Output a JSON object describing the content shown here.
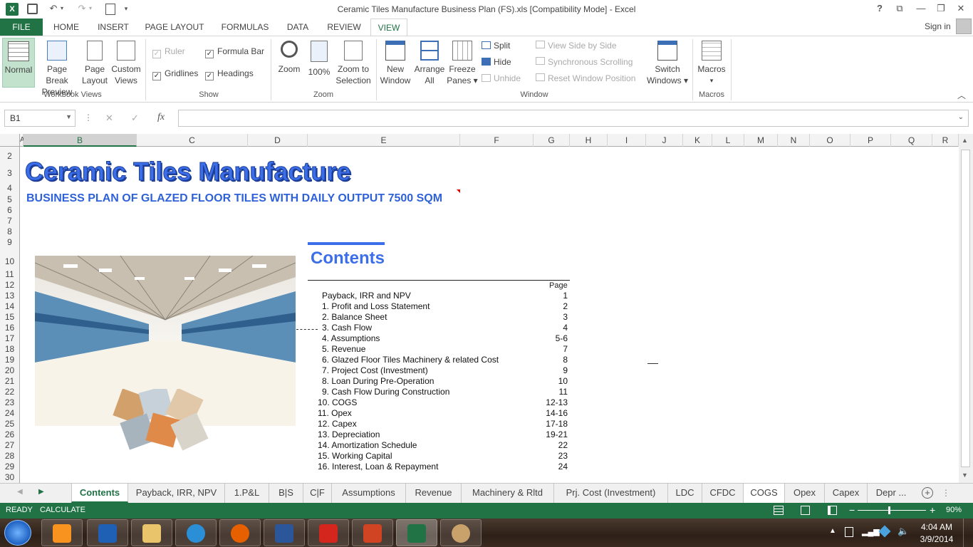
{
  "window": {
    "title": "Ceramic Tiles Manufacture Business Plan (FS).xls  [Compatibility Mode] - Excel",
    "help": "?",
    "sign_in": "Sign in"
  },
  "ribbon_tabs": [
    "FILE",
    "HOME",
    "INSERT",
    "PAGE LAYOUT",
    "FORMULAS",
    "DATA",
    "REVIEW",
    "VIEW"
  ],
  "ribbon": {
    "workbook_views": {
      "label": "Workbook Views",
      "normal": "Normal",
      "page_break": [
        "Page Break",
        "Preview"
      ],
      "page_layout": [
        "Page",
        "Layout"
      ],
      "custom": [
        "Custom",
        "Views"
      ]
    },
    "show": {
      "label": "Show",
      "ruler": "Ruler",
      "formula_bar": "Formula Bar",
      "gridlines": "Gridlines",
      "headings": "Headings"
    },
    "zoom": {
      "label": "Zoom",
      "zoom": "Zoom",
      "hundred": "100%",
      "zoom_sel": [
        "Zoom to",
        "Selection"
      ]
    },
    "window": {
      "label": "Window",
      "new_window": [
        "New",
        "Window"
      ],
      "arrange_all": [
        "Arrange",
        "All"
      ],
      "freeze": [
        "Freeze",
        "Panes"
      ],
      "split": "Split",
      "hide": "Hide",
      "unhide": "Unhide",
      "side_by_side": "View Side by Side",
      "sync_scroll": "Synchronous Scrolling",
      "reset_pos": "Reset Window Position",
      "switch": [
        "Switch",
        "Windows"
      ]
    },
    "macros": {
      "label": "Macros",
      "macros": "Macros"
    }
  },
  "formula_bar": {
    "name_box": "B1",
    "fx": "fx",
    "cancel": "✕",
    "enter": "✓",
    "value": ""
  },
  "columns": [
    "A",
    "B",
    "C",
    "D",
    "E",
    "F",
    "G",
    "H",
    "I",
    "J",
    "K",
    "L",
    "M",
    "N",
    "O",
    "P",
    "Q",
    "R"
  ],
  "rows": [
    "2",
    "3",
    "4",
    "5",
    "6",
    "7",
    "8",
    "9",
    "10",
    "11",
    "12",
    "13",
    "14",
    "15",
    "16",
    "17",
    "18",
    "19",
    "20",
    "21",
    "22",
    "23",
    "24",
    "25",
    "26",
    "27",
    "28",
    "29",
    "30"
  ],
  "sheet": {
    "title": "Ceramic Tiles Manufacture",
    "subtitle": "BUSINESS PLAN OF GLAZED FLOOR TILES WITH DAILY OUTPUT 7500 SQM",
    "contents_heading": "Contents",
    "page_header": "Page",
    "toc": [
      {
        "item": "Payback, IRR and NPV",
        "page": "1"
      },
      {
        "item": "1. Profit and Loss Statement",
        "page": "2"
      },
      {
        "item": "2. Balance Sheet",
        "page": "3"
      },
      {
        "item": "3. Cash Flow",
        "page": "4"
      },
      {
        "item": "4. Assumptions",
        "page": "5-6"
      },
      {
        "item": "5. Revenue",
        "page": "7"
      },
      {
        "item": "6. Glazed Floor Tiles Machinery & related Cost",
        "page": "8"
      },
      {
        "item": "7. Project Cost (Investment)",
        "page": "9"
      },
      {
        "item": "8. Loan During Pre-Operation",
        "page": "10"
      },
      {
        "item": "9. Cash Flow During Construction",
        "page": "11"
      },
      {
        "item": "10. COGS",
        "page": "12-13"
      },
      {
        "item": "11. Opex",
        "page": "14-16"
      },
      {
        "item": "12. Capex",
        "page": "17-18"
      },
      {
        "item": "13. Depreciation",
        "page": "19-21"
      },
      {
        "item": "14. Amortization Schedule",
        "page": "22"
      },
      {
        "item": "15. Working Capital",
        "page": "23"
      },
      {
        "item": "16. Interest, Loan & Repayment",
        "page": "24"
      }
    ]
  },
  "sheet_tabs": [
    "Contents",
    "Payback, IRR, NPV",
    "1.P&L",
    "B|S",
    "C|F",
    "Assumptions",
    "Revenue",
    "Machinery & Rltd",
    "Prj. Cost (Investment)",
    "LDC",
    "CFDC",
    "COGS",
    "Opex",
    "Capex",
    "Depr ..."
  ],
  "status": {
    "ready": "READY",
    "calculate": "CALCULATE",
    "zoom": "90%"
  },
  "taskbar": {
    "time": "4:04 AM",
    "date": "3/9/2014"
  },
  "colors": {
    "excel_green": "#217346",
    "title_blue": "#3B6EE8",
    "subtitle_blue": "#2F62D8"
  }
}
